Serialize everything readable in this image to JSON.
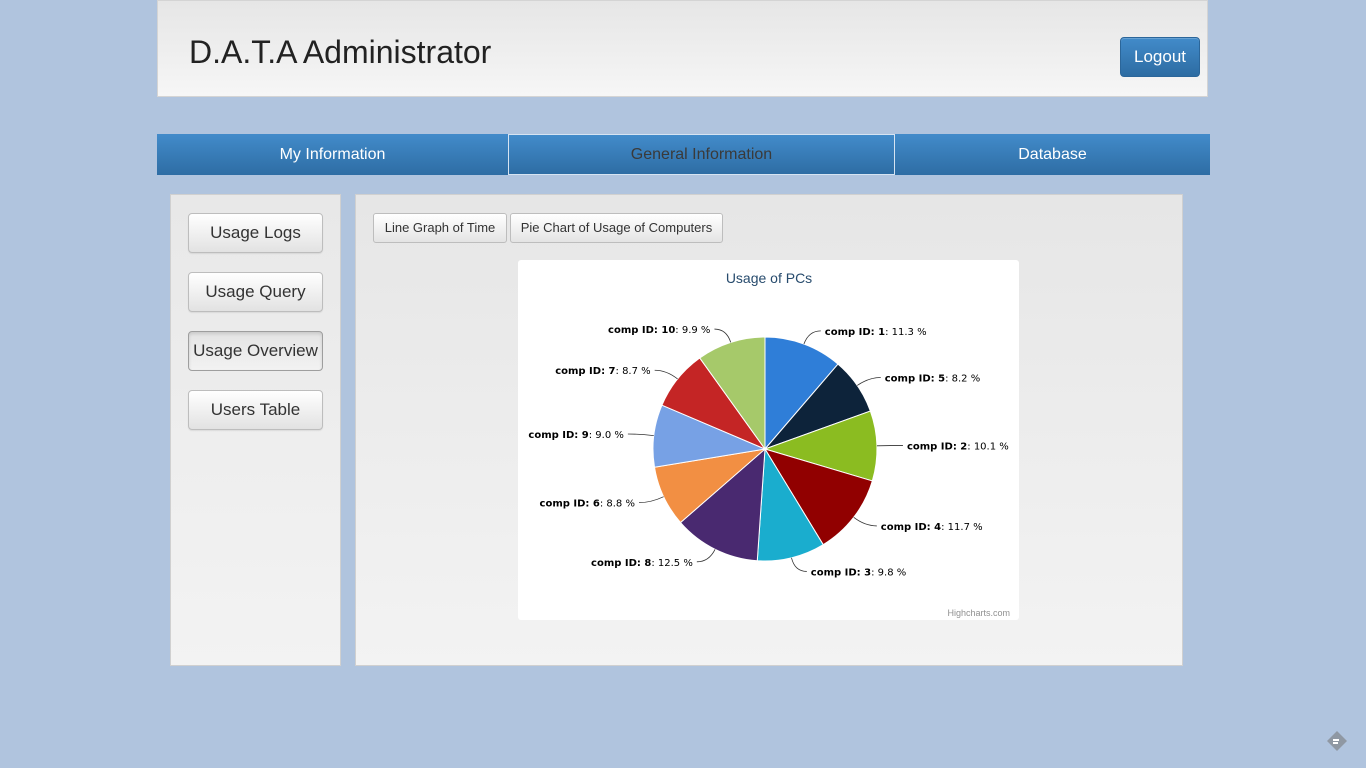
{
  "header": {
    "title": "D.A.T.A Administrator",
    "logout_label": "Logout"
  },
  "tabs": [
    {
      "label": "My Information"
    },
    {
      "label": "General Information"
    },
    {
      "label": "Database"
    }
  ],
  "sidebar": {
    "items": [
      {
        "label": "Usage Logs"
      },
      {
        "label": "Usage Query"
      },
      {
        "label": "Usage Overview"
      },
      {
        "label": "Users Table"
      }
    ]
  },
  "chart_toolbar": {
    "line_graph_label": "Line Graph of Time",
    "pie_chart_label": "Pie Chart of Usage of Computers"
  },
  "chart_data": {
    "type": "pie",
    "title": "Usage of PCs",
    "credits": "Highcharts.com",
    "series": [
      {
        "name": "comp ID",
        "id": "1",
        "value": 11.3,
        "color": "#2f7ed8"
      },
      {
        "name": "comp ID",
        "id": "5",
        "value": 8.2,
        "color": "#0d233a"
      },
      {
        "name": "comp ID",
        "id": "2",
        "value": 10.1,
        "color": "#8bbc21"
      },
      {
        "name": "comp ID",
        "id": "4",
        "value": 11.7,
        "color": "#910000"
      },
      {
        "name": "comp ID",
        "id": "3",
        "value": 9.8,
        "color": "#1aadce"
      },
      {
        "name": "comp ID",
        "id": "8",
        "value": 12.5,
        "color": "#492970"
      },
      {
        "name": "comp ID",
        "id": "6",
        "value": 8.8,
        "color": "#f28f43"
      },
      {
        "name": "comp ID",
        "id": "9",
        "value": 9.0,
        "color": "#77a1e5"
      },
      {
        "name": "comp ID",
        "id": "7",
        "value": 8.7,
        "color": "#c42525"
      },
      {
        "name": "comp ID",
        "id": "10",
        "value": 9.9,
        "color": "#a6c96a"
      }
    ]
  },
  "colors": {
    "background": "#b0c4de",
    "tab_blue": "#428bca",
    "title_text": "#274b6d"
  }
}
